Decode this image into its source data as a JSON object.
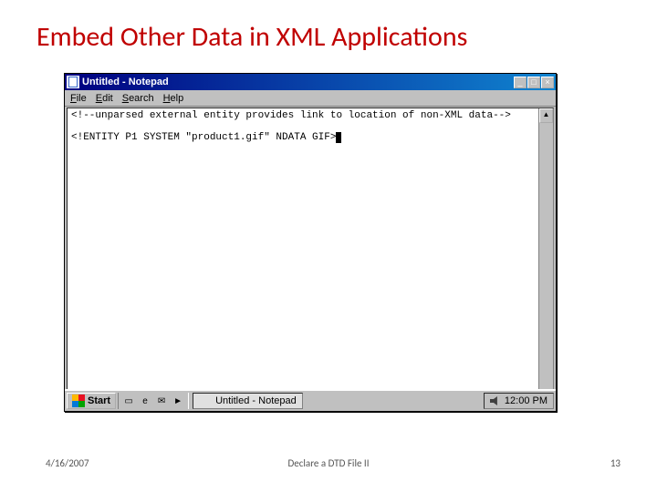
{
  "slide": {
    "title": "Embed Other Data in XML Applications",
    "date": "4/16/2007",
    "center_footer": "Declare a DTD File II",
    "page_number": "13"
  },
  "notepad": {
    "title": "Untitled - Notepad",
    "menu": {
      "file": "File",
      "edit": "Edit",
      "search": "Search",
      "help": "Help"
    },
    "content": {
      "line1": "<!--unparsed external entity provides link to location of non-XML data-->",
      "line2": "<!ENTITY P1 SYSTEM \"product1.gif\" NDATA GIF>"
    },
    "win_controls": {
      "minimize": "_",
      "maximize": "□",
      "close": "×"
    },
    "scroll": {
      "up": "▲",
      "down": "▼"
    }
  },
  "taskbar": {
    "start": "Start",
    "task_label": "Untitled - Notepad",
    "time": "12:00 PM"
  }
}
